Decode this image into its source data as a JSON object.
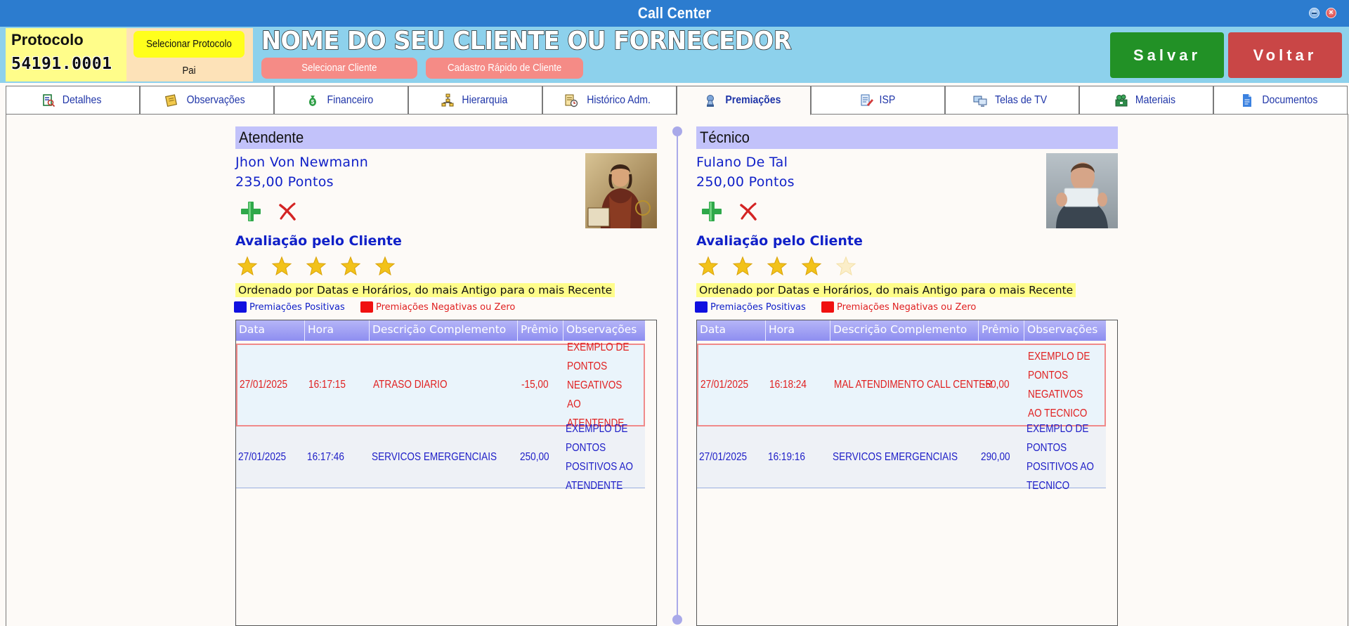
{
  "window": {
    "title": "Call Center"
  },
  "header": {
    "protocol_label": "Protocolo",
    "protocol_number": "54191.0001",
    "select_parent_label": "Selecionar Protocolo Pai",
    "client_name": "NOME DO SEU CLIENTE OU FORNECEDOR",
    "select_client_label": "Selecionar Cliente",
    "quick_register_label": "Cadastro Rápido de Cliente",
    "save_label": "Salvar",
    "back_label": "Voltar"
  },
  "tabs": [
    {
      "label": "Detalhes",
      "icon": "document-search-icon"
    },
    {
      "label": "Observações",
      "icon": "notes-icon"
    },
    {
      "label": "Financeiro",
      "icon": "money-bag-icon"
    },
    {
      "label": "Hierarquia",
      "icon": "hierarchy-icon"
    },
    {
      "label": "Histórico Adm.",
      "icon": "history-icon"
    },
    {
      "label": "Premiações",
      "icon": "trophy-icon",
      "active": true
    },
    {
      "label": "ISP",
      "icon": "edit-list-icon"
    },
    {
      "label": "Telas de TV",
      "icon": "tv-screens-icon"
    },
    {
      "label": "Materiais",
      "icon": "materials-icon"
    },
    {
      "label": "Documentos",
      "icon": "document-icon"
    }
  ],
  "panels": {
    "attendant": {
      "heading": "Atendente",
      "name": "Jhon Von Newmann",
      "points": "235,00 Pontos",
      "evaluation_title": "Avaliação pelo Cliente",
      "rating": 5,
      "max_rating": 5,
      "ordered_note": "Ordenado por Datas e Horários, do mais Antigo para o mais Recente",
      "legend_positive": "Premiações Positivas",
      "legend_negative": "Premiações Negativas ou Zero",
      "columns": [
        "Data",
        "Hora",
        "Descrição Complemento",
        "Prêmio",
        "Observações"
      ],
      "rows": [
        {
          "data": "27/01/2025",
          "hora": "16:17:15",
          "descricao": "ATRASO DIARIO",
          "premio": "-15,00",
          "obs": "EXEMPLO DE PONTOS NEGATIVOS AO ATENTENDE",
          "type": "negative"
        },
        {
          "data": "27/01/2025",
          "hora": "16:17:46",
          "descricao": "SERVICOS EMERGENCIAIS",
          "premio": "250,00",
          "obs": "EXEMPLO DE PONTOS POSITIVOS AO ATENDENTE",
          "type": "positive"
        }
      ]
    },
    "technician": {
      "heading": "Técnico",
      "name": "Fulano De Tal",
      "points": "250,00 Pontos",
      "evaluation_title": "Avaliação pelo Cliente",
      "rating": 4,
      "max_rating": 5,
      "ordered_note": "Ordenado por Datas e Horários, do mais Antigo para o mais Recente",
      "legend_positive": "Premiações Positivas",
      "legend_negative": "Premiações Negativas ou Zero",
      "columns": [
        "Data",
        "Hora",
        "Descrição Complemento",
        "Prêmio",
        "Observações"
      ],
      "rows": [
        {
          "data": "27/01/2025",
          "hora": "16:18:24",
          "descricao": "MAL ATENDIMENTO CALL CENTER",
          "premio": "-50,00",
          "obs": "EXEMPLO DE PONTOS NEGATIVOS AO TECNICO",
          "type": "negative"
        },
        {
          "data": "27/01/2025",
          "hora": "16:19:16",
          "descricao": "SERVICOS EMERGENCIAIS",
          "premio": "290,00",
          "obs": "EXEMPLO DE PONTOS POSITIVOS AO TECNICO",
          "type": "positive"
        }
      ]
    }
  },
  "colors": {
    "titlebar": "#2c7ccf",
    "header": "#8dd1ec",
    "save": "#229126",
    "back": "#c94646",
    "positive": "#2020c8",
    "negative": "#e02020",
    "legend_positive_swatch": "#1010e0",
    "legend_negative_swatch": "#f01010",
    "star": "#f2c21a"
  }
}
